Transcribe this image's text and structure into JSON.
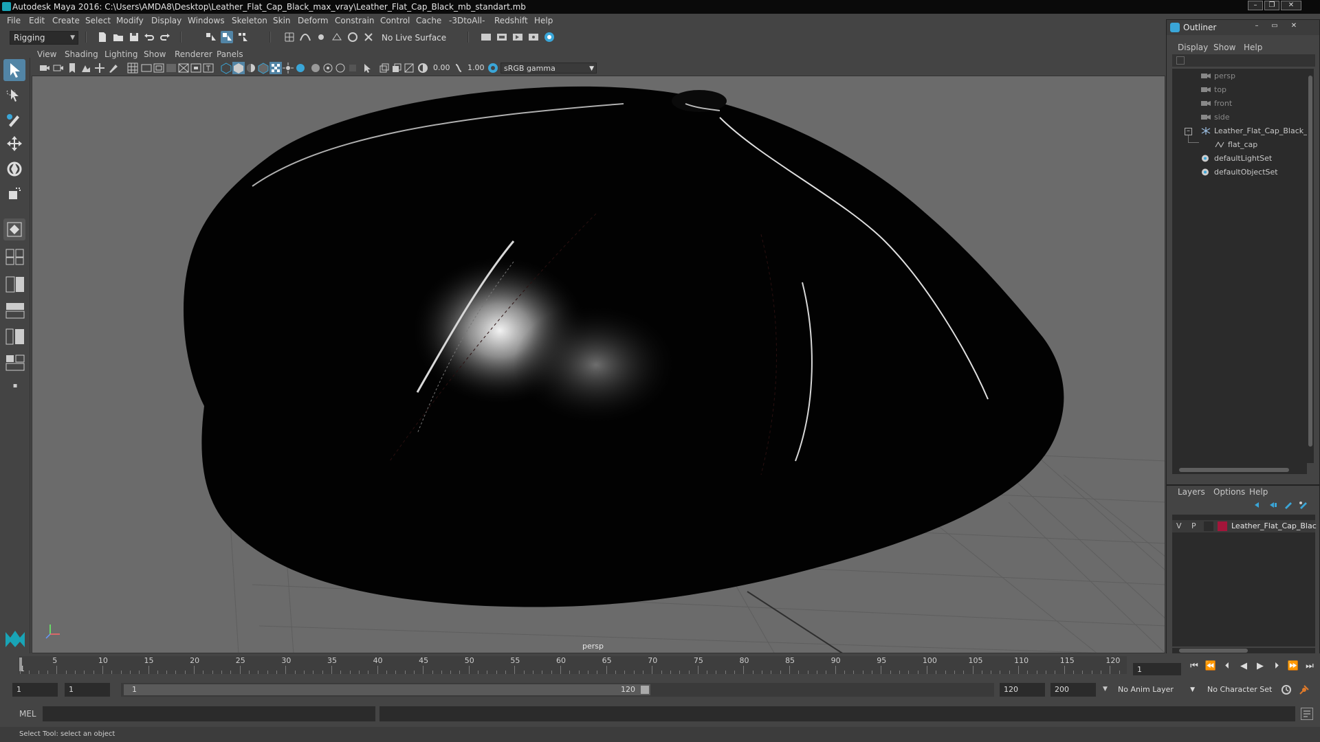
{
  "window": {
    "title": "Autodesk Maya 2016: C:\\Users\\AMDA8\\Desktop\\Leather_Flat_Cap_Black_max_vray\\Leather_Flat_Cap_Black_mb_standart.mb"
  },
  "menubar": [
    "File",
    "Edit",
    "Create",
    "Select",
    "Modify",
    "Display",
    "Windows",
    "Skeleton",
    "Skin",
    "Deform",
    "Constrain",
    "Control",
    "Cache",
    "-3DtoAll-",
    "Redshift",
    "Help"
  ],
  "statusline": {
    "mode": "Rigging",
    "live_surface": "No Live Surface"
  },
  "panel_menu": [
    "View",
    "Shading",
    "Lighting",
    "Show",
    "Renderer",
    "Panels"
  ],
  "panel_toolbar": {
    "exposure": "0.00",
    "gamma": "1.00",
    "color_space": "sRGB gamma"
  },
  "viewport": {
    "camera_label": "persp"
  },
  "outliner": {
    "title": "Outliner",
    "menu": [
      "Display",
      "Show",
      "Help"
    ],
    "items": [
      {
        "label": "persp",
        "type": "camera"
      },
      {
        "label": "top",
        "type": "camera"
      },
      {
        "label": "front",
        "type": "camera"
      },
      {
        "label": "side",
        "type": "camera"
      },
      {
        "label": "Leather_Flat_Cap_Black_r",
        "type": "group"
      },
      {
        "label": "flat_cap",
        "type": "mesh"
      },
      {
        "label": "defaultLightSet",
        "type": "set"
      },
      {
        "label": "defaultObjectSet",
        "type": "set"
      }
    ]
  },
  "layers": {
    "menu": [
      "Layers",
      "Options",
      "Help"
    ],
    "rows": [
      {
        "v": "V",
        "p": "P",
        "name": "Leather_Flat_Cap_Blac",
        "color": "#a3153a"
      }
    ]
  },
  "timeline": {
    "ticks": [
      "5",
      "10",
      "15",
      "20",
      "25",
      "30",
      "35",
      "40",
      "45",
      "50",
      "55",
      "60",
      "65",
      "70",
      "75",
      "80",
      "85",
      "90",
      "95",
      "100",
      "105",
      "110",
      "115",
      "120"
    ],
    "first_tick": "1",
    "current_frame": "1"
  },
  "range": {
    "start": "1",
    "playback_start": "1",
    "slider_start": "1",
    "slider_end": "120",
    "playback_end": "120",
    "end": "200",
    "anim_layer": "No Anim Layer",
    "character_set": "No Character Set"
  },
  "cmdline": {
    "language": "MEL"
  },
  "helpline": {
    "text": "Select Tool: select an object"
  },
  "colors": {
    "accent": "#5285a6",
    "maya_teal": "#19a4b6"
  }
}
